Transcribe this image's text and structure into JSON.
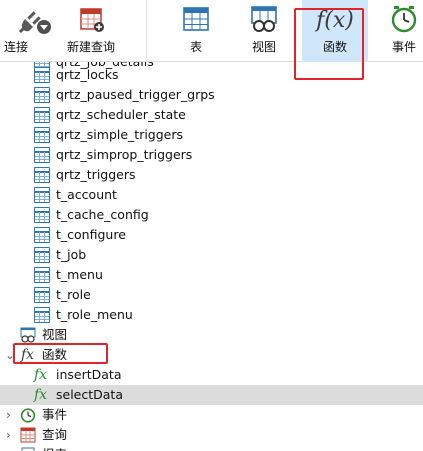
{
  "toolbar": {
    "connect_label": "连接",
    "new_query_label": "新建查询",
    "table_label": "表",
    "view_label": "视图",
    "function_label": "函数",
    "event_label": "事件",
    "function_icon_text": "f(x)"
  },
  "tree": {
    "top_partial_label": "qrtz_job_details",
    "tables": [
      "qrtz_locks",
      "qrtz_paused_trigger_grps",
      "qrtz_scheduler_state",
      "qrtz_simple_triggers",
      "qrtz_simprop_triggers",
      "qrtz_triggers",
      "t_account",
      "t_cache_config",
      "t_configure",
      "t_job",
      "t_menu",
      "t_role",
      "t_role_menu"
    ],
    "views_label": "视图",
    "functions_label": "函数",
    "fx_glyph": "fx",
    "functions": [
      "insertData",
      "selectData"
    ],
    "events_label": "事件",
    "queries_label": "查询",
    "reports_label": "报表"
  },
  "colors": {
    "highlight_border": "#e0242a",
    "active_toolbar_bg": "#d0e7fb",
    "selected_row_bg": "#dcdcdc",
    "table_icon": "#2e75b6",
    "function_icon": "#2e8b2e"
  }
}
